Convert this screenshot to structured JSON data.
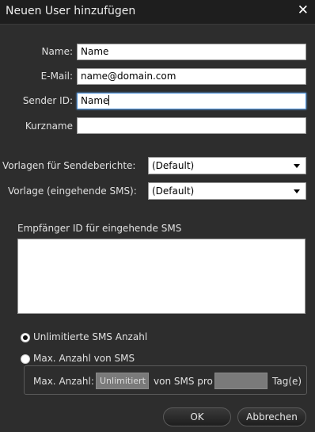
{
  "dialog": {
    "title": "Neuen User hinzufügen",
    "close_glyph": "✕"
  },
  "form": {
    "name": {
      "label": "Name:",
      "value": "Name"
    },
    "email": {
      "label": "E-Mail:",
      "value": "name@domain.com"
    },
    "sender_id": {
      "label": "Sender ID:",
      "value": "Name"
    },
    "kurzname": {
      "label": "Kurzname",
      "value": ""
    },
    "vorlage_sendeberichte": {
      "label": "Vorlagen für Sendeberichte:",
      "selected": "(Default)"
    },
    "vorlage_eingehende": {
      "label": "Vorlage (eingehende SMS):",
      "selected": "(Default)"
    },
    "empfaenger_id": {
      "label": "Empfänger ID für eingehende SMS",
      "value": ""
    }
  },
  "sms_limit": {
    "unlimited_label": "Unlimitierte SMS Anzahl",
    "max_label": "Max. Anzahl von SMS",
    "max_count_label": "Max. Anzahl:",
    "max_count_value": "Unlimitiert",
    "per_label": "von SMS pro",
    "days_value": "",
    "days_label": "Tag(e)",
    "selected": "unlimited"
  },
  "buttons": {
    "ok": "OK",
    "cancel": "Abbrechen"
  },
  "colors": {
    "background": "#2d2d2d",
    "titlebar": "#1e1e1e",
    "focus_border": "#4a8fd6"
  }
}
